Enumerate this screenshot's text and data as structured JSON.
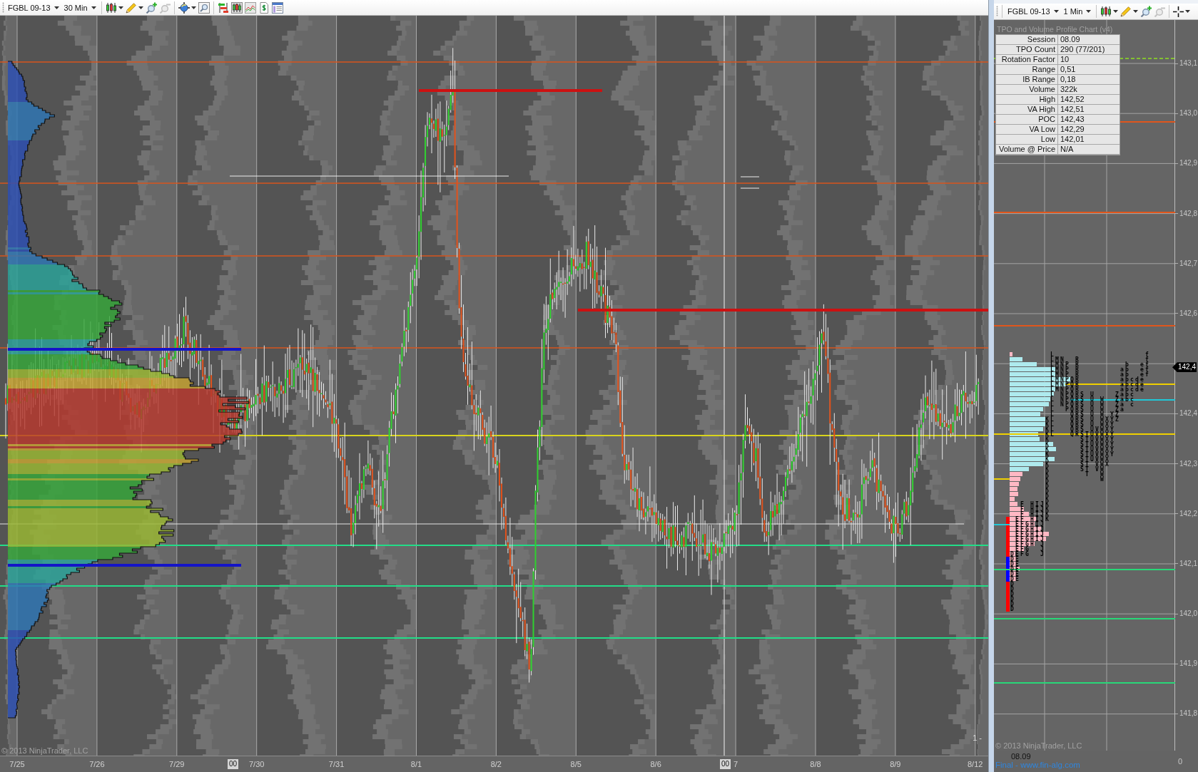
{
  "main_chart": {
    "toolbar": {
      "instrument": "FGBL 09-13",
      "interval": "30 Min"
    },
    "copyright": "© 2013 NinjaTrader, LLC",
    "scale_label": "1 -",
    "date_axis": [
      "7/25",
      "7/26",
      "7/29",
      "7/30",
      "7/31",
      "8/1",
      "8/2",
      "8/5",
      "8/6",
      "7",
      "8/8",
      "8/9",
      "8/12"
    ],
    "cursor_tags": [
      "00",
      "00"
    ]
  },
  "tpo_chart": {
    "toolbar": {
      "instrument": "FGBL 09-13",
      "interval": "1 Min"
    },
    "title": "TPO and Volume Profile Chart (v4)",
    "stats": [
      {
        "label": "Session",
        "value": "08.09"
      },
      {
        "label": "TPO Count",
        "value": "290 (77/201)"
      },
      {
        "label": "Rotation Factor",
        "value": "10"
      },
      {
        "label": "Range",
        "value": "0,51"
      },
      {
        "label": "IB Range",
        "value": "0,18"
      },
      {
        "label": "Volume",
        "value": "322k"
      },
      {
        "label": "High",
        "value": "142,52"
      },
      {
        "label": "VA High",
        "value": "142,51"
      },
      {
        "label": "POC",
        "value": "142,43"
      },
      {
        "label": "VA Low",
        "value": "142,29"
      },
      {
        "label": "Low",
        "value": "142,01"
      },
      {
        "label": "Volume @ Price",
        "value": "N/A"
      }
    ],
    "tpo_rows": [
      "        L                  f",
      "        LMN  R             f",
      "        LMNP R         b  ef",
      "        LMNP R        ab  ef",
      "        LMNP R        ab  ef",
      "        LMNPQR        abcde",
      "        LMNPQR        abcde",
      "        LMNPQR        abcde",
      "        L NPQRS U    Zabc",
      "        L NPQRS U W  Zabc",
      "        L NPQRS U W  Za c",
      "        L  PQRS U W  Za",
      "        L   QRS U W YZ",
      "       KL   QRS U WXYZ",
      "       KL   QRS U WXY",
      "       KL   QRS UVWXY",
      "       KL   QRSTUVWXY",
      "       K      STUVWXY",
      "       K      STUVWXY",
      "       K      STUVWXY",
      "       K      STUVWXY",
      "       K      STUVWX",
      "       K      ST VWX",
      "       K      ST VW",
      "       K       T  W",
      "       K          W",
      "       K",
      "       K",
      "       K",
      "       K",
      "  F HIJK",
      "  F HIJK",
      "  F HIJK",
      " EF HIJK",
      " EFGHIJ",
      " EFGHIJ",
      " EFGHIJ",
      " EFGHIJ",
      " EFGH J",
      " EFG  J",
      "DEFG  J",
      "DE",
      "DE",
      "DE",
      "DE",
      "DE",
      "D",
      "D",
      "D",
      "D",
      "D",
      "D"
    ],
    "copyright": "© 2013 NinjaTrader, LLC",
    "price_axis": [
      {
        "kind": "tick",
        "label": "143,1"
      },
      {
        "kind": "tick",
        "label": "143,0"
      },
      {
        "kind": "tick",
        "label": "142,9"
      },
      {
        "kind": "tick",
        "label": "142,8"
      },
      {
        "kind": "tick",
        "label": "142,7"
      },
      {
        "kind": "tick",
        "label": "142,6"
      },
      {
        "kind": "marker",
        "label": "142,4"
      },
      {
        "kind": "tick",
        "label": "142,4"
      },
      {
        "kind": "tick",
        "label": "142,3"
      },
      {
        "kind": "tick",
        "label": "142,2"
      },
      {
        "kind": "tick",
        "label": "142,1"
      },
      {
        "kind": "tick",
        "label": "142,0"
      },
      {
        "kind": "tick",
        "label": "141,9"
      },
      {
        "kind": "tick",
        "label": "141,8"
      }
    ],
    "session_label": "08.09",
    "source_label": "Final - www.fin-alg.com",
    "axis_zero": "0"
  }
}
